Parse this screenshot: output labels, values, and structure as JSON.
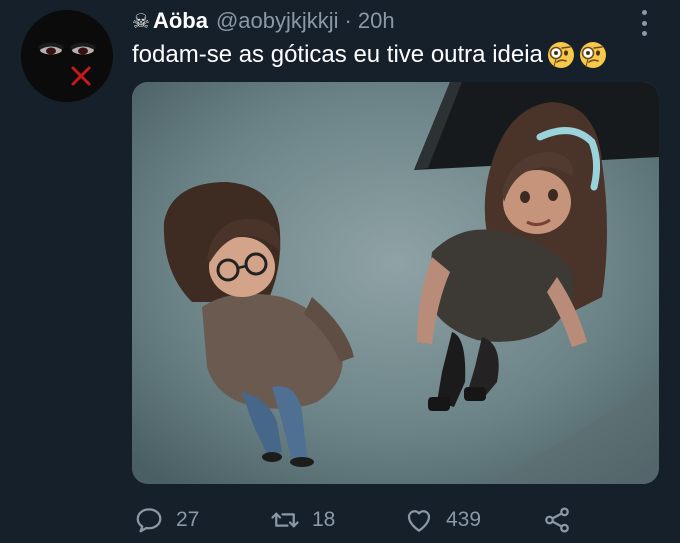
{
  "tweet": {
    "user": {
      "name_emoji": "☠",
      "display_name": "Aöba",
      "handle": "@aobyjkjkkji",
      "separator": "·",
      "time": "20h"
    },
    "text": "fodam-se as góticas eu tive outra ideia",
    "text_emojis": [
      "face-with-monocle-emoji",
      "face-with-monocle-emoji"
    ],
    "media": {
      "kind": "illustration",
      "subject": "two-cartoon-girls-looking-up"
    },
    "actions": {
      "replies": "27",
      "retweets": "18",
      "likes": "439"
    }
  },
  "colors": {
    "background": "#15202b",
    "secondary_text": "#8b98a5",
    "primary_text": "#ffffff"
  },
  "icons": [
    "skull-crossbones-icon",
    "more-vertical-icon",
    "reply-icon",
    "retweet-icon",
    "like-icon",
    "share-icon"
  ]
}
